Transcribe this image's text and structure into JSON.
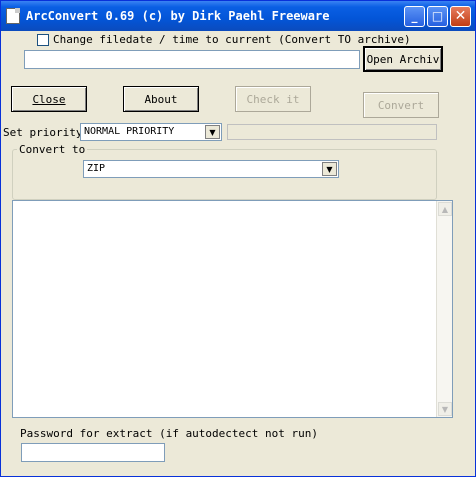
{
  "window": {
    "title": "ArcConvert 0.69 (c) by Dirk Paehl Freeware",
    "minimize_glyph": "_",
    "maximize_glyph": "□",
    "close_glyph": "✕"
  },
  "options": {
    "change_filedate_label": "Change filedate / time to current (Convert TO archive)",
    "change_filedate_checked": false
  },
  "archive": {
    "path_value": "",
    "open_button": "Open Archiv"
  },
  "buttons": {
    "close": "Close",
    "about": "About",
    "check": "Check it",
    "convert": "Convert"
  },
  "priority": {
    "label": "Set priority",
    "value": "NORMAL PRIORITY"
  },
  "convert_to": {
    "legend": "Convert to",
    "value": "ZIP"
  },
  "log": {
    "content": ""
  },
  "password": {
    "label": "Password for extract (if autodectect not run)",
    "value": ""
  },
  "icons": {
    "scroll_up": "▲",
    "scroll_down": "▼",
    "dropdown": "▼"
  }
}
